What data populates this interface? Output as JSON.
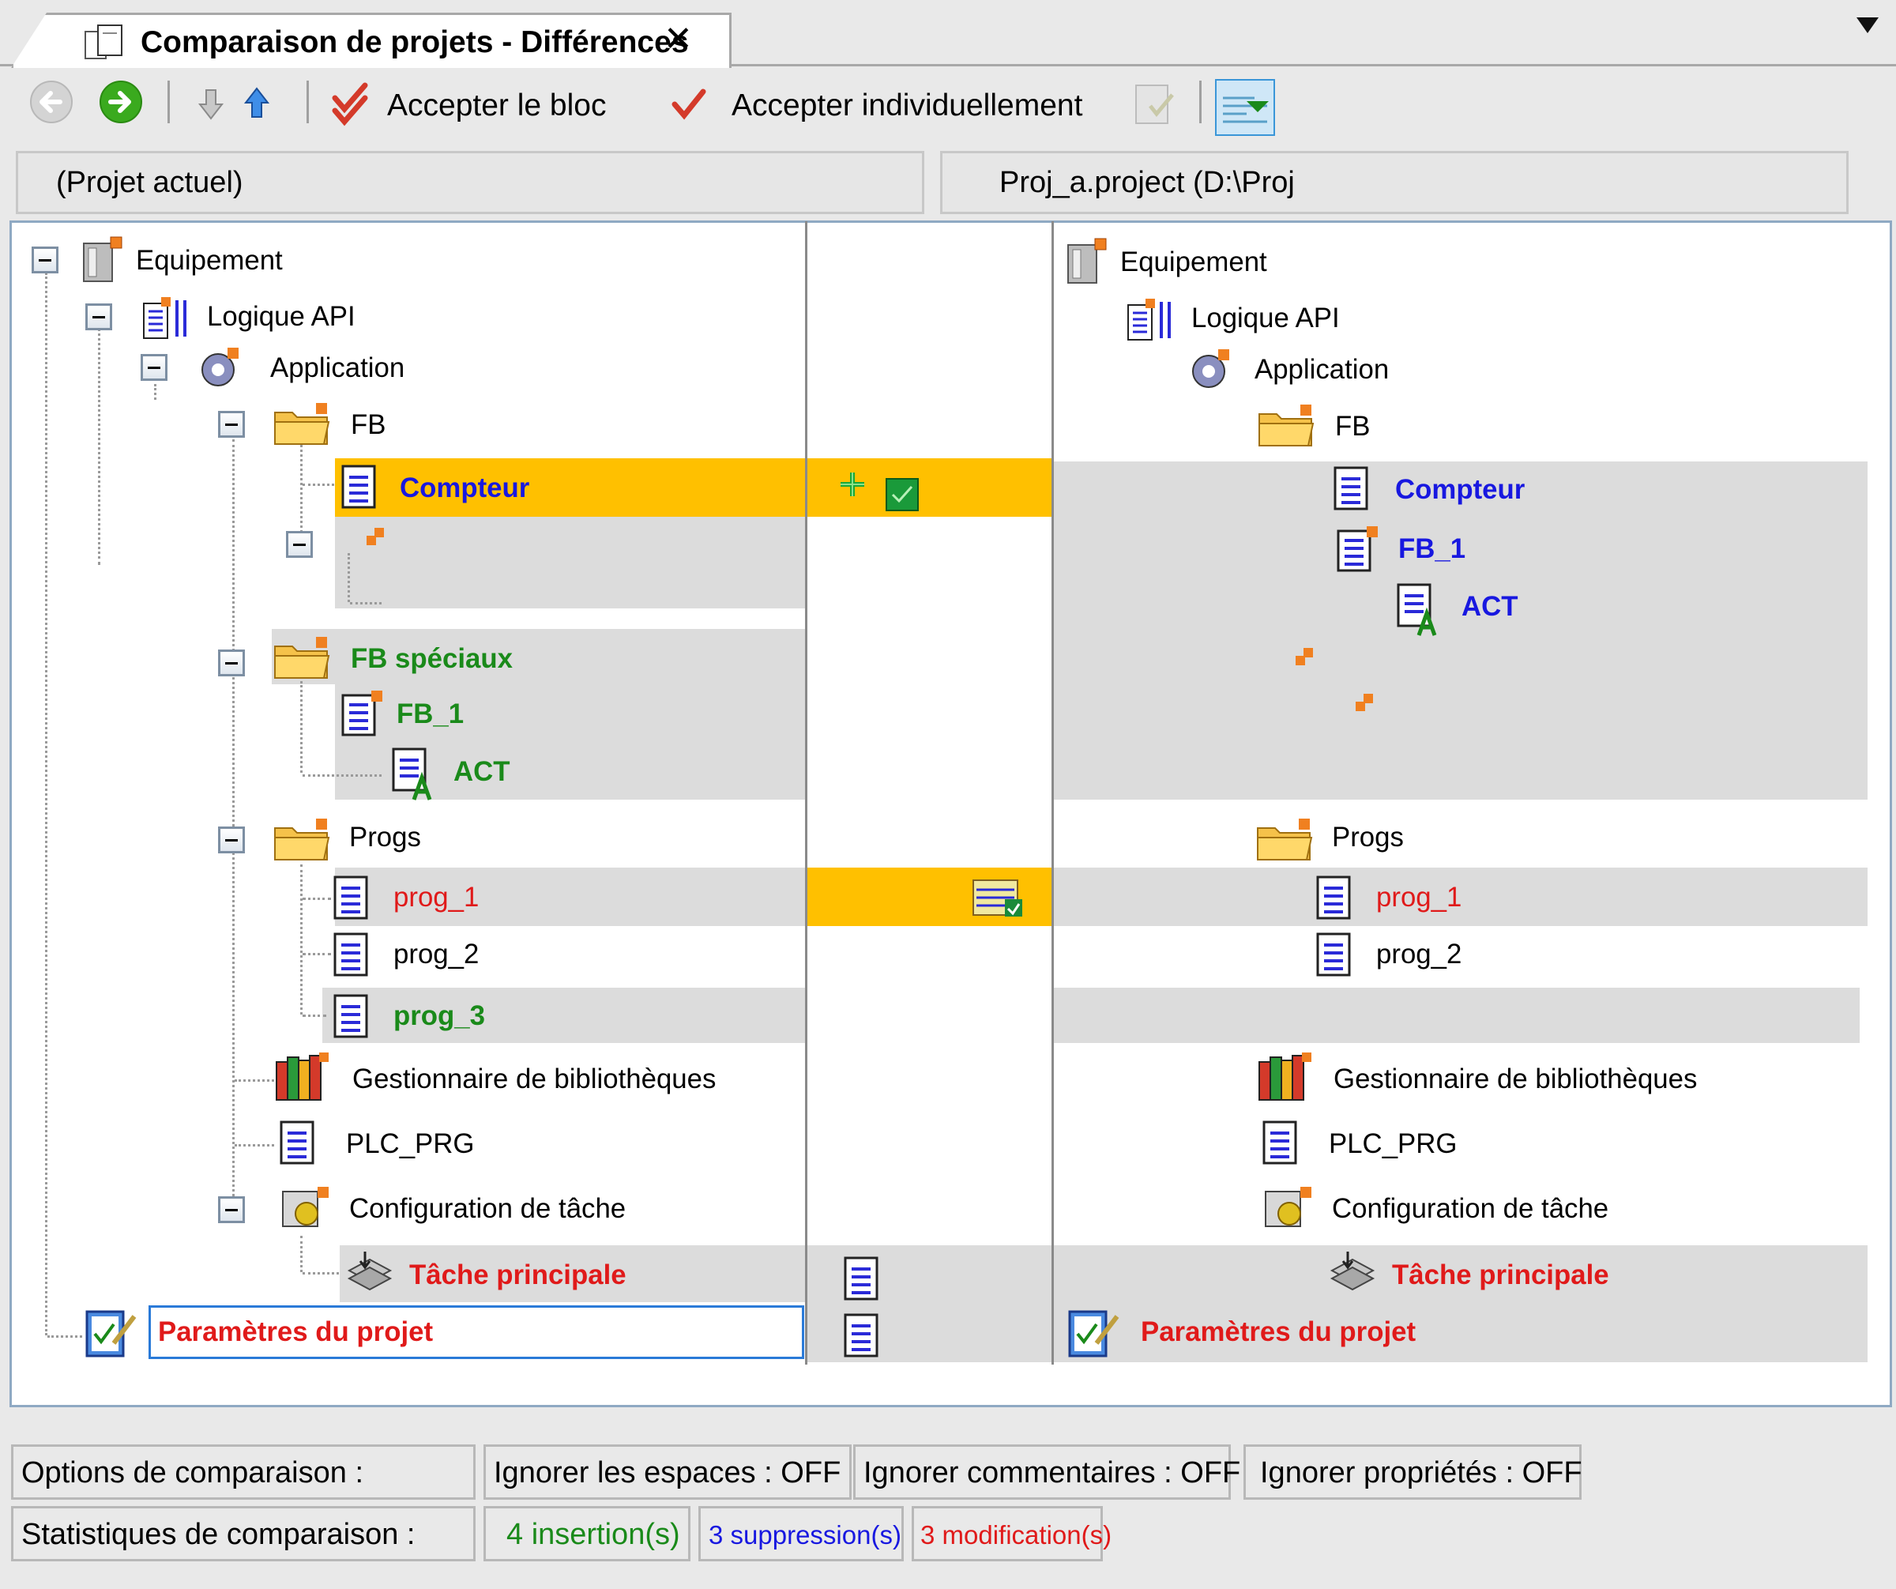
{
  "tab": {
    "title": "Comparaison de projets - Différences",
    "close": "✕"
  },
  "toolbar": {
    "back_icon": "arrow-left-circle-icon",
    "forward_icon": "arrow-right-circle-icon",
    "accept_block": "Accepter le bloc",
    "accept_individual": "Accepter individuellement"
  },
  "columns": {
    "left": "(Projet actuel)",
    "right": "Proj_a.project (D:\\Proj"
  },
  "left_tree": {
    "equipement": "Equipement",
    "logique": "Logique API",
    "application": "Application",
    "fb": "FB",
    "compteur": "Compteur",
    "fb_speciaux": "FB spéciaux",
    "fb_1": "FB_1",
    "act": "ACT",
    "progs": "Progs",
    "prog_1": "prog_1",
    "prog_2": "prog_2",
    "prog_3": "prog_3",
    "gestionnaire": "Gestionnaire de bibliothèques",
    "plc_prg": "PLC_PRG",
    "config": "Configuration de tâche",
    "tache": "Tâche principale",
    "parametres": "Paramètres du projet"
  },
  "right_tree": {
    "equipement": "Equipement",
    "logique": "Logique API",
    "application": "Application",
    "fb": "FB",
    "compteur": "Compteur",
    "fb_1": "FB_1",
    "act": "ACT",
    "progs": "Progs",
    "prog_1": "prog_1",
    "prog_2": "prog_2",
    "gestionnaire": "Gestionnaire de bibliothèques",
    "plc_prg": "PLC_PRG",
    "config": "Configuration de tâche",
    "tache": "Tâche principale",
    "parametres": "Paramètres du projet"
  },
  "options": {
    "label": "Options de comparaison :",
    "spaces": "Ignorer les espaces : OFF",
    "comments": "Ignorer commentaires : OFF",
    "properties": "Ignorer propriétés : OFF"
  },
  "stats": {
    "label": "Statistiques de comparaison :",
    "insertions": "4 insertion(s)",
    "deletions": "3 suppression(s)",
    "modifications": "3 modification(s)"
  },
  "colors": {
    "highlight": "#ffc000",
    "changed_band": "#dcdcdc",
    "inserted": "#1a8a1a",
    "deleted": "#1818e0",
    "modified": "#e01a1a"
  }
}
